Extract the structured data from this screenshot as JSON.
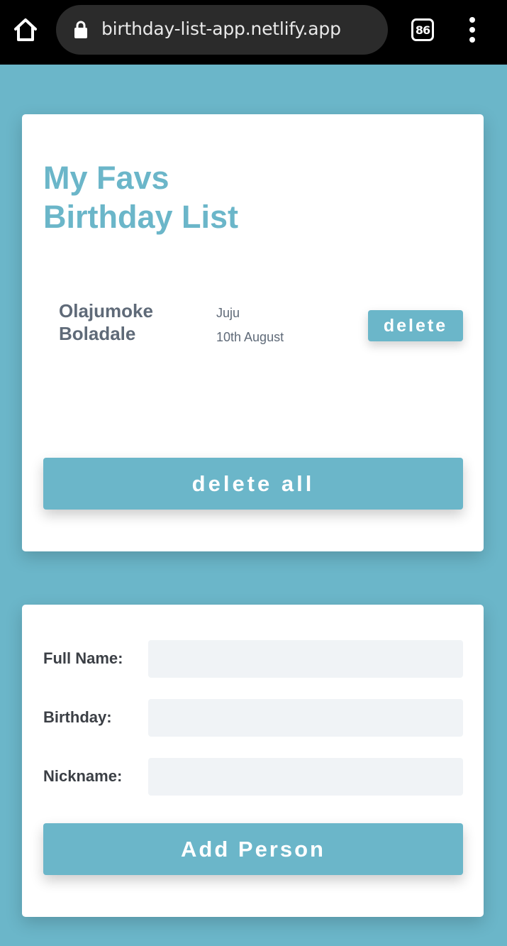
{
  "browser": {
    "url": "birthday-list-app.netlify.app",
    "tab_count": "86",
    "icons": [
      "home-icon",
      "lock-icon",
      "tabs-icon",
      "more-vertical-icon"
    ]
  },
  "list_card": {
    "title_line1": "My Favs",
    "title_line2": "Birthday List",
    "people": [
      {
        "full_name": "Olajumoke Boladale",
        "nickname": "Juju",
        "birthday": "10th August",
        "delete_label": "delete"
      }
    ],
    "delete_all_label": "delete all"
  },
  "form": {
    "full_name_label": "Full Name:",
    "full_name_value": "",
    "birthday_label": "Birthday:",
    "birthday_value": "",
    "nickname_label": "Nickname:",
    "nickname_value": "",
    "submit_label": "Add Person"
  },
  "colors": {
    "accent": "#6bb6c9",
    "text_dark": "#3b3f45",
    "text_muted": "#5f6a78",
    "input_bg": "#f0f3f6"
  }
}
